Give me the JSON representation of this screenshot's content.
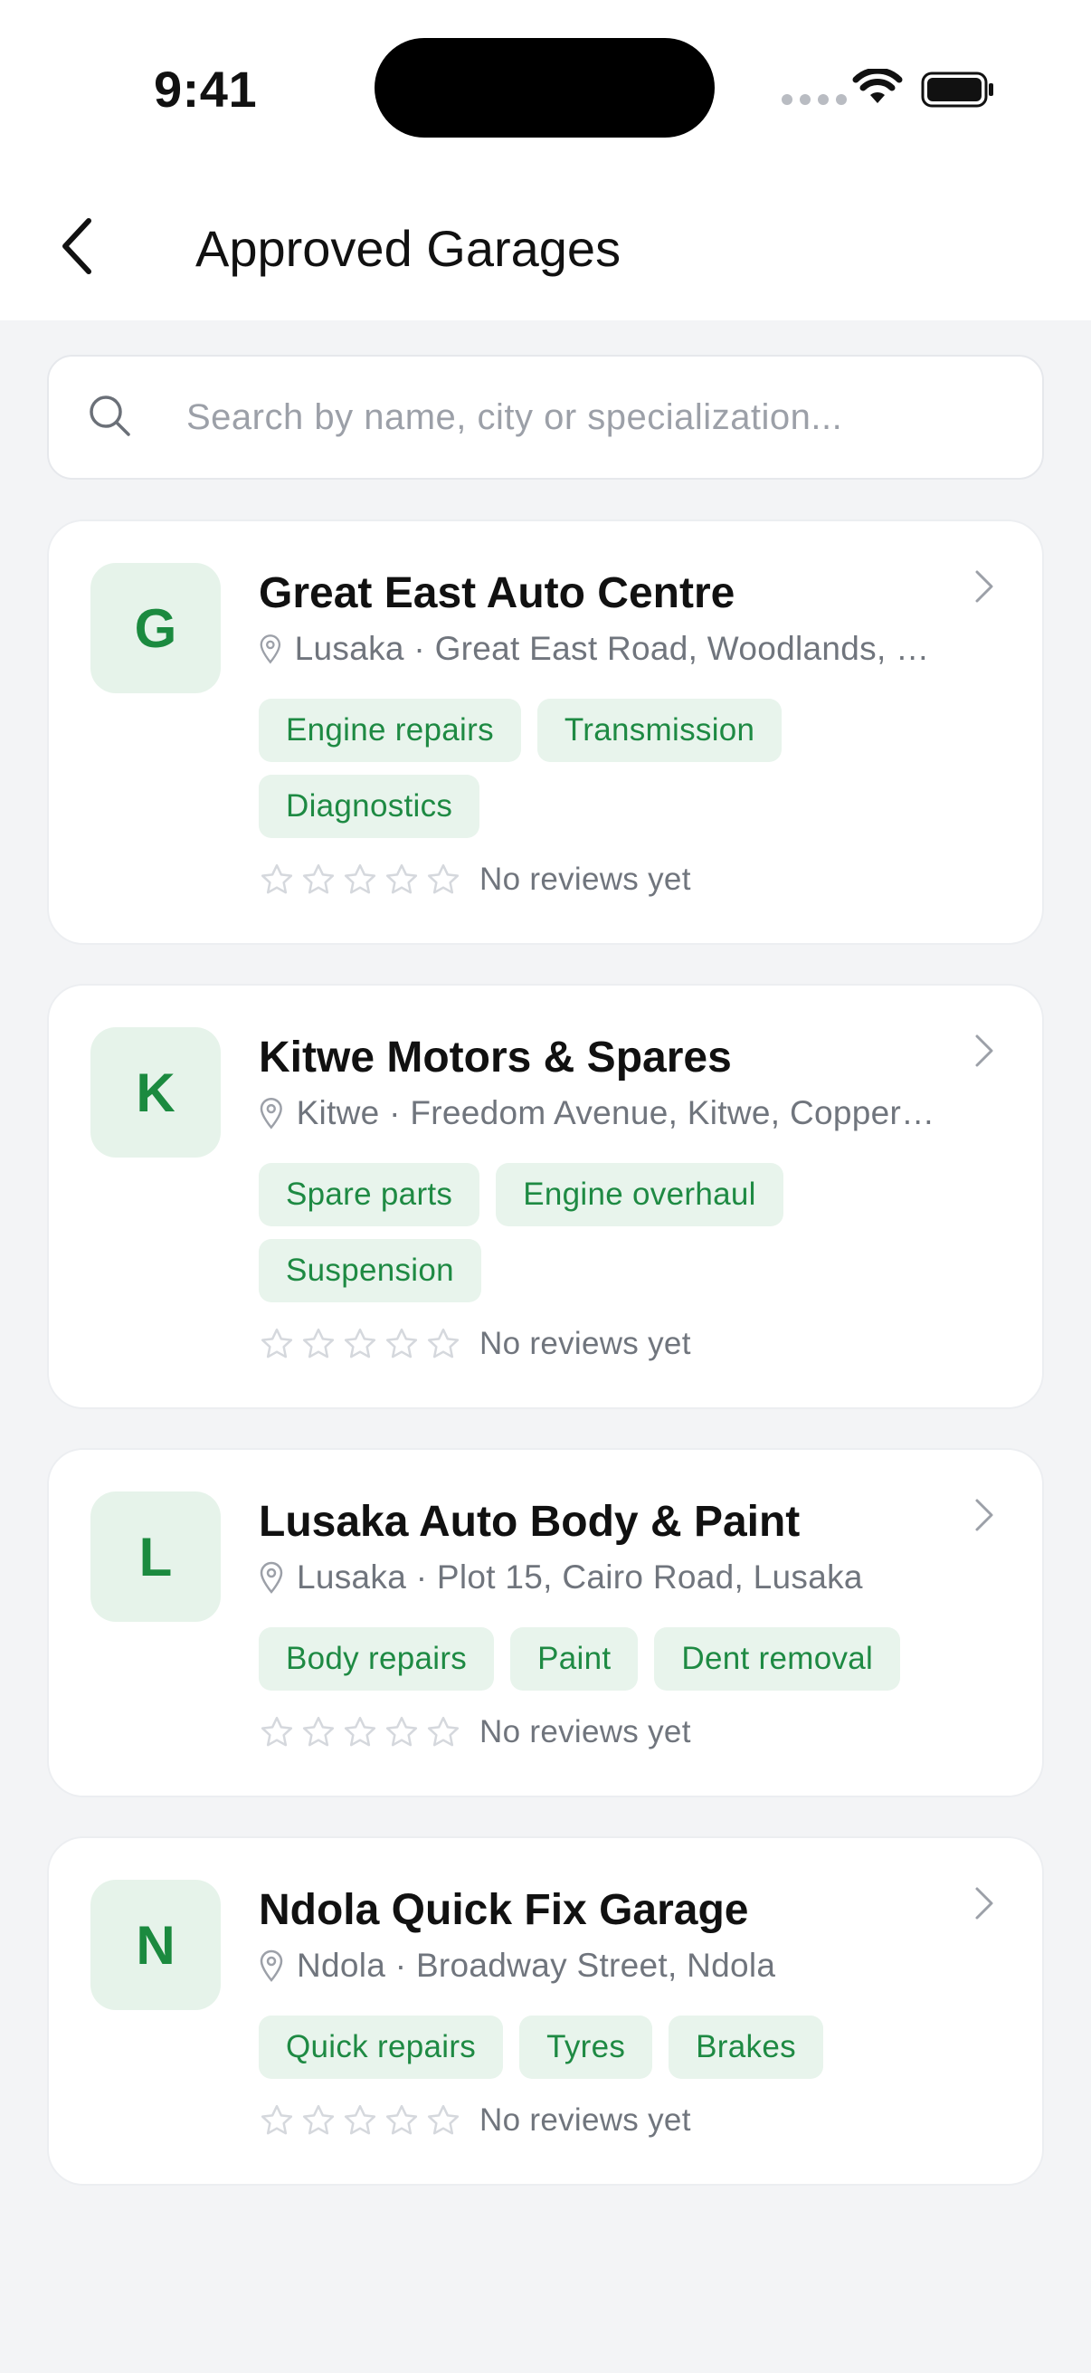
{
  "status": {
    "time": "9:41"
  },
  "header": {
    "title": "Approved Garages"
  },
  "search": {
    "placeholder": "Search by name, city or specialization..."
  },
  "garages": [
    {
      "initial": "G",
      "name": "Great East Auto Centre",
      "location": "Lusaka · Great East Road, Woodlands, Lusaka",
      "tags": [
        "Engine repairs",
        "Transmission",
        "Diagnostics"
      ],
      "rating_text": "No reviews yet"
    },
    {
      "initial": "K",
      "name": "Kitwe Motors & Spares",
      "location": "Kitwe · Freedom Avenue, Kitwe, Copperbelt",
      "tags": [
        "Spare parts",
        "Engine overhaul",
        "Suspension"
      ],
      "rating_text": "No reviews yet"
    },
    {
      "initial": "L",
      "name": "Lusaka Auto Body & Paint",
      "location": "Lusaka · Plot 15, Cairo Road, Lusaka",
      "tags": [
        "Body repairs",
        "Paint",
        "Dent removal"
      ],
      "rating_text": "No reviews yet"
    },
    {
      "initial": "N",
      "name": "Ndola Quick Fix Garage",
      "location": "Ndola · Broadway Street, Ndola",
      "tags": [
        "Quick repairs",
        "Tyres",
        "Brakes"
      ],
      "rating_text": "No reviews yet"
    }
  ],
  "colors": {
    "accent": "#1b8a3f",
    "tag_bg": "#e8f4ec",
    "background": "#f3f4f6"
  }
}
